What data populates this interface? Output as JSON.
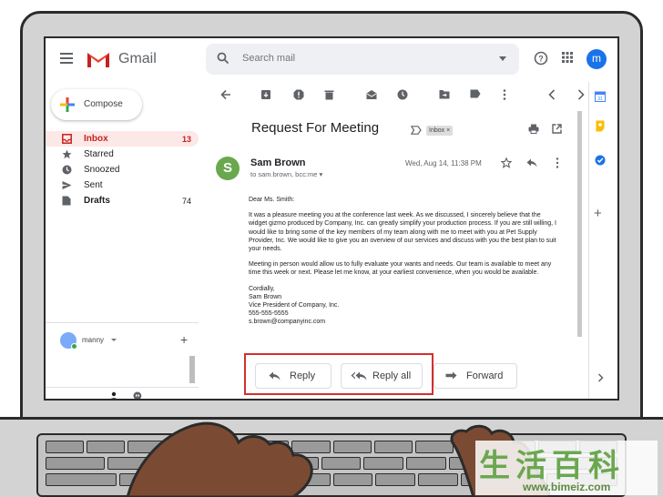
{
  "app": {
    "name": "Gmail",
    "search_placeholder": "Search mail",
    "avatar_letter": "m"
  },
  "compose": {
    "label": "Compose"
  },
  "sidebar": {
    "items": [
      {
        "label": "Inbox",
        "count": "13",
        "icon": "inbox-icon",
        "active": true
      },
      {
        "label": "Starred",
        "count": "",
        "icon": "star-icon"
      },
      {
        "label": "Snoozed",
        "count": "",
        "icon": "clock-icon"
      },
      {
        "label": "Sent",
        "count": "",
        "icon": "send-icon"
      },
      {
        "label": "Drafts",
        "count": "74",
        "icon": "draft-icon"
      }
    ]
  },
  "hangouts": {
    "user": "manny"
  },
  "message": {
    "subject": "Request For Meeting",
    "label_chip": "Inbox ×",
    "sender_initial": "S",
    "sender_name": "Sam Brown",
    "to_line": "to sam.brown, bcc:me ▾",
    "date": "Wed, Aug 14, 11:38 PM",
    "greeting": "Dear Ms. Smith:",
    "para1": "It was a pleasure meeting you at the conference last week. As we discussed, I sincerely believe that the widget gizmo produced by Company, Inc. can greatly simplify your production process. If you are still willing, I would like to bring some of the key members of my team along with me to meet with you at Pet Supply Provider, Inc. We would like to give you an overview of our services and discuss with you the best plan to suit your needs.",
    "para2": "Meeting in person would allow us to fully evaluate your wants and needs. Our team is available to meet any time this week or next. Please let me know, at your earliest convenience, when you would be available.",
    "closing": "Cordially,",
    "sig_name": "Sam Brown",
    "sig_title": "Vice President of Company, Inc.",
    "sig_phone": "555-555-5555",
    "sig_email": "s.brown@companyinc.com"
  },
  "actions": {
    "reply": "Reply",
    "reply_all": "Reply all",
    "forward": "Forward"
  },
  "watermark": {
    "chars": "生活百科",
    "url": "www.bimeiz.com"
  },
  "colors": {
    "highlight": "#d32f2f",
    "inbox_active_bg": "#fce8e6",
    "avatar_blue": "#1a73e8",
    "sender_green": "#6aa84f"
  }
}
